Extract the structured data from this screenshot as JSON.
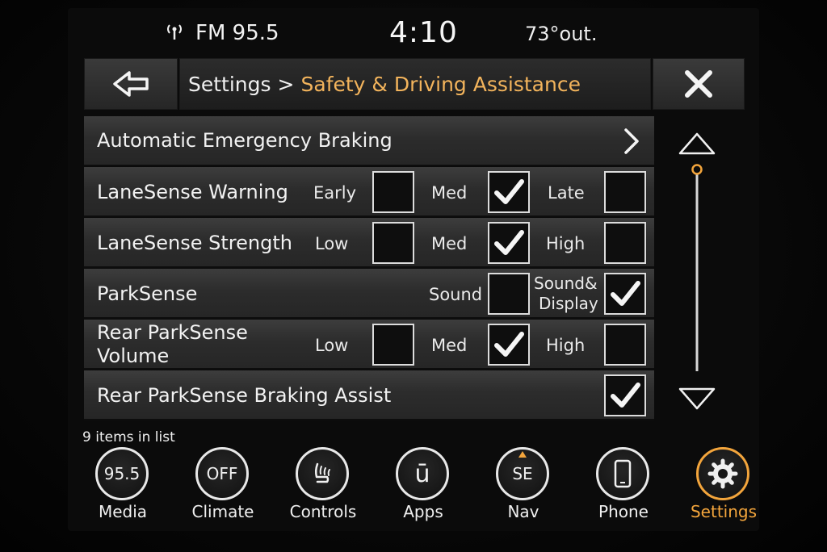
{
  "status": {
    "radio": "FM 95.5",
    "time": "4:10",
    "temperature": "73°out."
  },
  "header": {
    "breadcrumb_root": "Settings",
    "breadcrumb_sep": ">",
    "breadcrumb_current": "Safety & Driving Assistance"
  },
  "rows": {
    "aeb": {
      "label": "Automatic Emergency Braking"
    },
    "lane_warning": {
      "label": "LaneSense Warning",
      "options": [
        {
          "label": "Early",
          "checked": false
        },
        {
          "label": "Med",
          "checked": true
        },
        {
          "label": "Late",
          "checked": false
        }
      ]
    },
    "lane_strength": {
      "label": "LaneSense Strength",
      "options": [
        {
          "label": "Low",
          "checked": false
        },
        {
          "label": "Med",
          "checked": true
        },
        {
          "label": "High",
          "checked": false
        }
      ]
    },
    "parksense": {
      "label": "ParkSense",
      "options": [
        {
          "label": "Sound",
          "checked": false
        },
        {
          "label_line1": "Sound&",
          "label_line2": "Display",
          "checked": true
        }
      ]
    },
    "rear_volume": {
      "label_line1": "Rear ParkSense",
      "label_line2": "Volume",
      "options": [
        {
          "label": "Low",
          "checked": false
        },
        {
          "label": "Med",
          "checked": true
        },
        {
          "label": "High",
          "checked": false
        }
      ]
    },
    "rear_braking": {
      "label": "Rear ParkSense Braking Assist",
      "checked": true
    }
  },
  "scroll": {
    "position": 0.0
  },
  "list_count": "9 items in list",
  "nav": {
    "media": {
      "icon_text": "95.5",
      "label": "Media"
    },
    "climate": {
      "icon_text": "OFF",
      "label": "Climate"
    },
    "controls": {
      "label": "Controls"
    },
    "apps": {
      "icon_text": "ū",
      "label": "Apps"
    },
    "nav": {
      "icon_text": "SE",
      "label": "Nav"
    },
    "phone": {
      "label": "Phone"
    },
    "settings": {
      "label": "Settings"
    }
  },
  "colors": {
    "accent": "#f3a53c",
    "breadcrumb_current": "#f3b45c",
    "row_bg": "#2f2f2f",
    "text": "#f0f0f0"
  },
  "icons": [
    "radio-signal-icon",
    "back-arrow-icon",
    "close-icon",
    "chevron-right-icon",
    "checkmark-icon",
    "scroll-up-icon",
    "scroll-down-icon",
    "seat-icon",
    "nav-arrow-icon",
    "phone-icon",
    "gear-icon"
  ]
}
